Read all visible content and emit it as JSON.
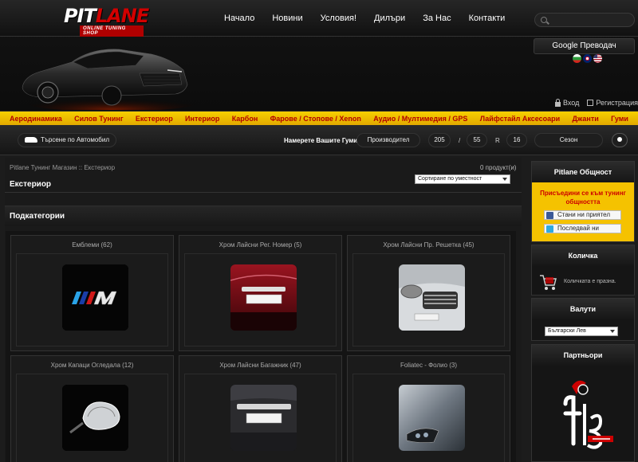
{
  "logo": {
    "brand_left": "PIT",
    "brand_right": "LANE",
    "tagline": "ONLINE TUNING SHOP"
  },
  "nav": [
    "Начало",
    "Новини",
    "Условия!",
    "Дилъри",
    "За Нас",
    "Контакти"
  ],
  "search": {
    "placeholder": ""
  },
  "translate": "Google Преводач",
  "auth": {
    "login": "Вход",
    "register": "Регистрация"
  },
  "categories": [
    "Аеродинамика",
    "Силов Тунинг",
    "Екстериор",
    "Интериор",
    "Карбон",
    "Фарове / Стопове / Xenon",
    "Аудио / Мултимедия / GPS",
    "Лайфстайл Аксесоари",
    "Джанти",
    "Гуми"
  ],
  "tyres": {
    "car_search": "Търсене по Автомобил",
    "label": "Намерете Вашите Гуми:",
    "manufacturer": "Производител",
    "width": "205",
    "slash": "/",
    "profile": "55",
    "r": "R",
    "rim": "16",
    "season": "Сезон"
  },
  "content": {
    "breadcrumb": "Pitlane Тунинг Магазин :: Екстериор",
    "products_count": "0 продукт(и)",
    "title": "Екстериор",
    "sort": "Сортиране по уместност",
    "subcategories_title": "Подкатегории",
    "subcategories": [
      {
        "title": "Емблеми (62)"
      },
      {
        "title": "Хром Лайсни Рег. Номер (5)"
      },
      {
        "title": "Хром Лайсни Пр. Решетка (45)"
      },
      {
        "title": "Хром Капаци Огледала (12)"
      },
      {
        "title": "Хром Лайсни Багажник (47)"
      },
      {
        "title": "Foliatec - Фолио (3)"
      }
    ]
  },
  "sidebar": {
    "community": {
      "title": "Pitlane Общност",
      "join": "Присъедини се към тунинг общността",
      "facebook": "Стани ни приятел",
      "twitter": "Последвай ни"
    },
    "cart": {
      "title": "Количка",
      "empty": "Количката е празна."
    },
    "currency": {
      "title": "Валути",
      "selected": "Български Лев"
    },
    "partners": {
      "title": "Партньори"
    }
  },
  "colors": {
    "accent_yellow": "#f2c000",
    "accent_red": "#c00000",
    "background": "#1c1c1c"
  }
}
